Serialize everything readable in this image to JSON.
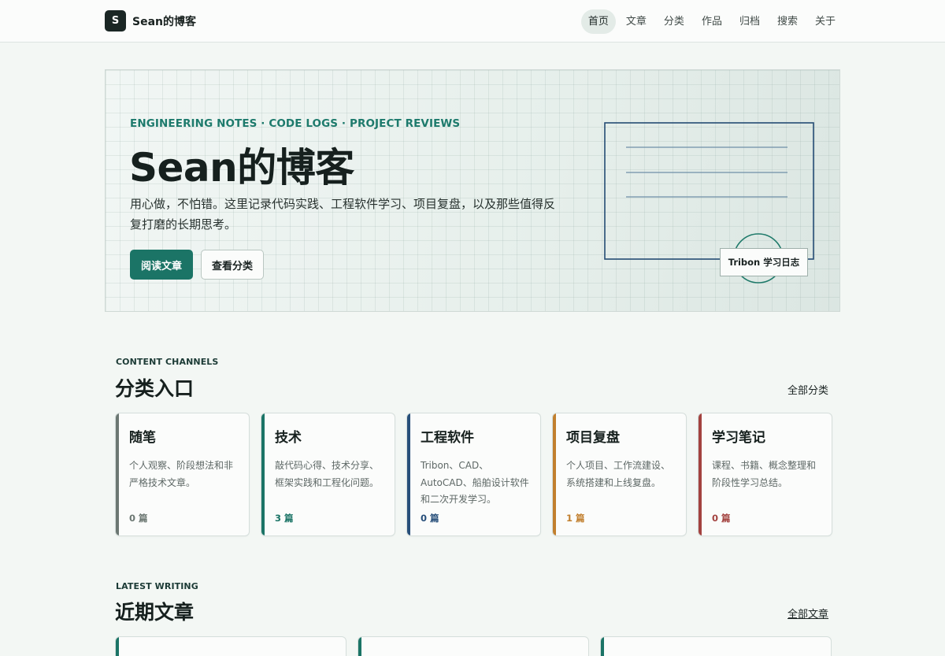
{
  "header": {
    "logo_letter": "S",
    "site_name": "Sean的博客",
    "nav": [
      {
        "label": "首页",
        "active": true
      },
      {
        "label": "文章"
      },
      {
        "label": "分类"
      },
      {
        "label": "作品"
      },
      {
        "label": "归档"
      },
      {
        "label": "搜索"
      },
      {
        "label": "关于"
      }
    ]
  },
  "hero": {
    "kicker": "ENGINEERING NOTES · CODE LOGS · PROJECT REVIEWS",
    "title": "Sean的博客",
    "description": "用心做，不怕错。这里记录代码实践、工程软件学习、项目复盘，以及那些值得反复打磨的长期思考。",
    "primary_button": "阅读文章",
    "secondary_button": "查看分类",
    "art_tag": "Tribon 学习日志"
  },
  "categories_section": {
    "eyebrow": "CONTENT CHANNELS",
    "title": "分类入口",
    "link": "全部分类",
    "cards": [
      {
        "title": "随笔",
        "description": "个人观察、阶段想法和非严格技术文章。",
        "count": "0 篇",
        "color": "#6b7772"
      },
      {
        "title": "技术",
        "description": "敲代码心得、技术分享、框架实践和工程化问题。",
        "count": "3 篇",
        "color": "#1b7466"
      },
      {
        "title": "工程软件",
        "description": "Tribon、CAD、AutoCAD、船舶设计软件和二次开发学习。",
        "count": "0 篇",
        "color": "#274f7a"
      },
      {
        "title": "项目复盘",
        "description": "个人项目、工作流建设、系统搭建和上线复盘。",
        "count": "1 篇",
        "color": "#c17f2e"
      },
      {
        "title": "学习笔记",
        "description": "课程、书籍、概念整理和阶段性学习总结。",
        "count": "0 篇",
        "color": "#a3423f"
      }
    ]
  },
  "recent_section": {
    "eyebrow": "LATEST WRITING",
    "title": "近期文章",
    "link": "全部文章"
  }
}
